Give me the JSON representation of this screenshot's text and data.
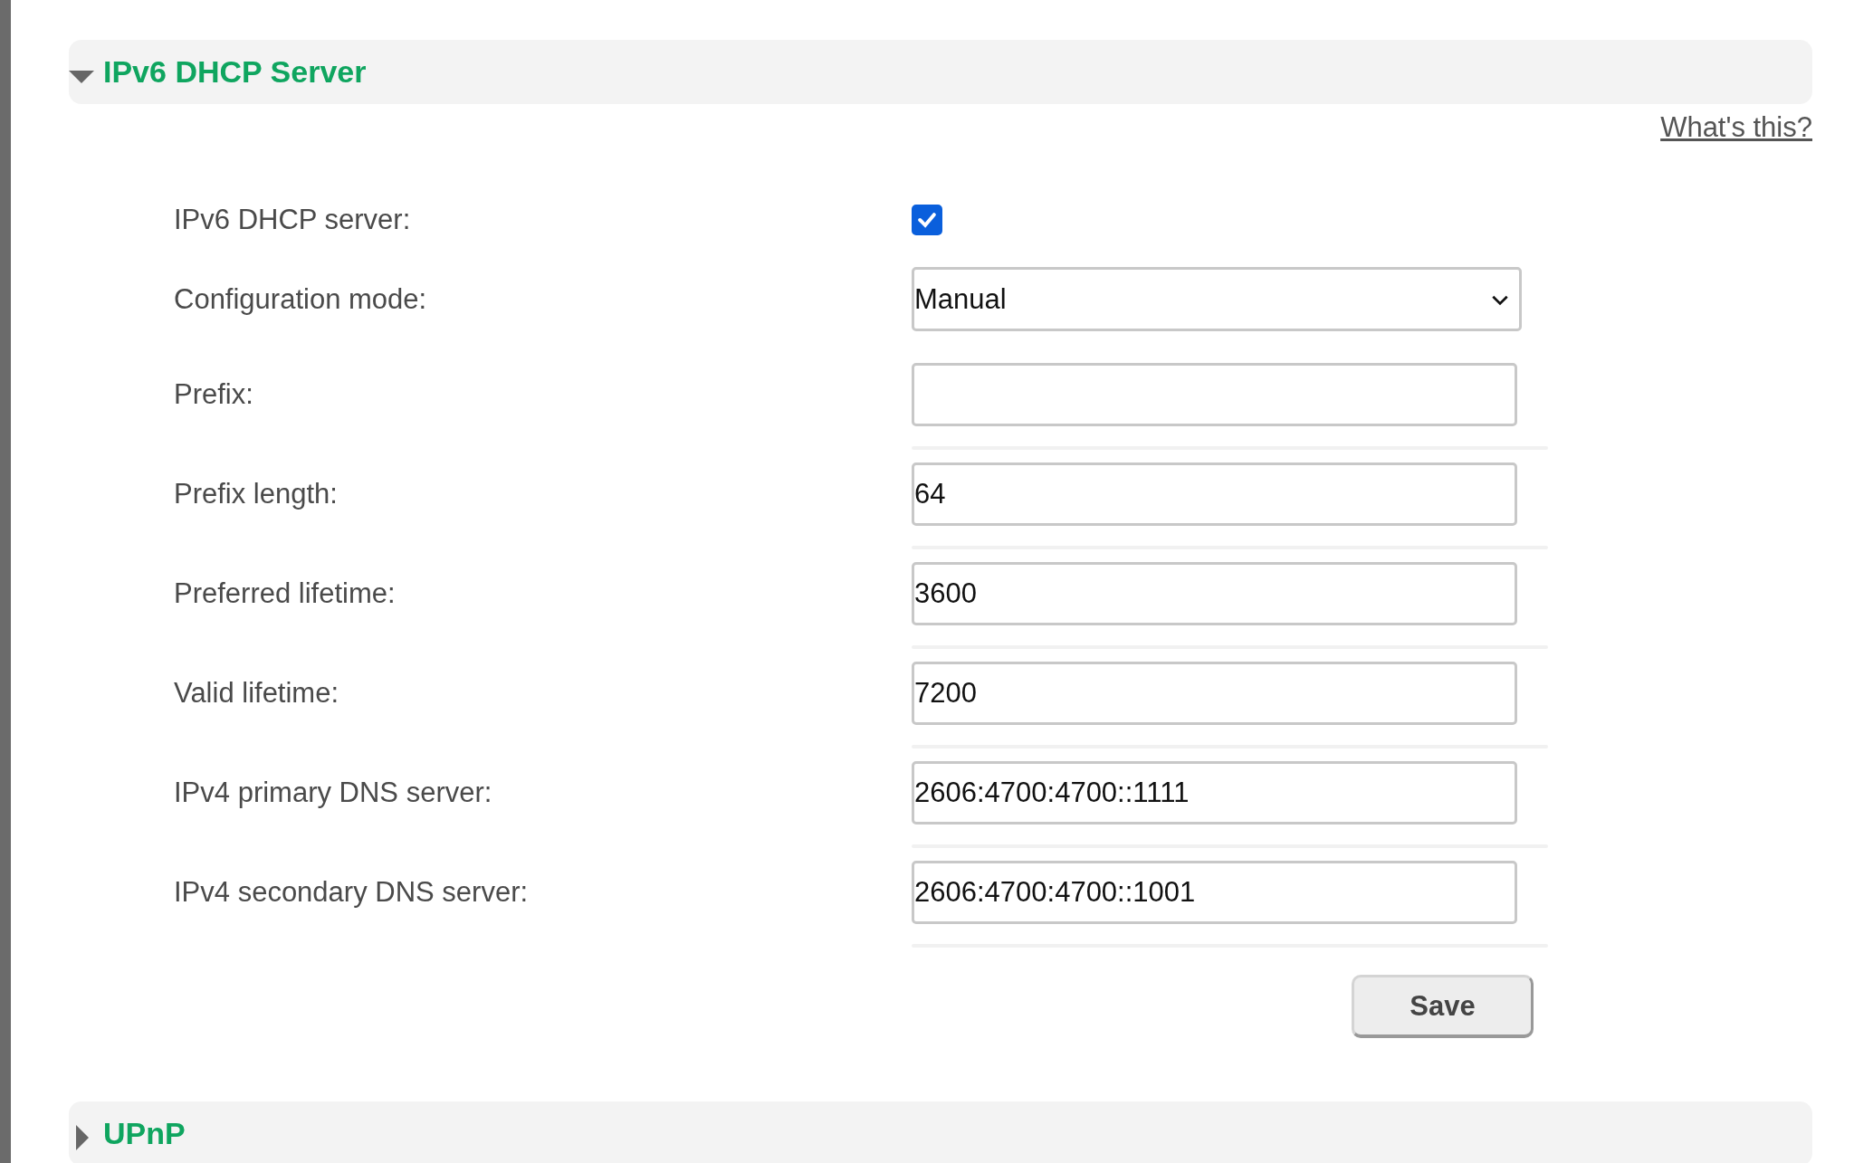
{
  "sections": [
    {
      "title": "IPv6 DHCP Server",
      "expanded": true,
      "help_link": "What's this?",
      "fields": [
        {
          "kind": "checkbox",
          "label": "IPv6 DHCP server:",
          "checked": true
        },
        {
          "kind": "select",
          "label": "Configuration mode:",
          "value": "Manual"
        },
        {
          "kind": "text",
          "label": "Prefix:"
        },
        {
          "kind": "text",
          "label": "Prefix length:",
          "value": "64"
        },
        {
          "kind": "text",
          "label": "Preferred lifetime:",
          "value": "3600"
        },
        {
          "kind": "text",
          "label": "Valid lifetime:",
          "value": "7200"
        },
        {
          "kind": "text",
          "label": "IPv4 primary DNS server:",
          "value": "2606:4700:4700::1111"
        },
        {
          "kind": "text",
          "label": "IPv4 secondary DNS server:",
          "value": "2606:4700:4700::1001"
        }
      ],
      "save_button": "Save"
    },
    {
      "title": "UPnP",
      "expanded": false
    }
  ]
}
